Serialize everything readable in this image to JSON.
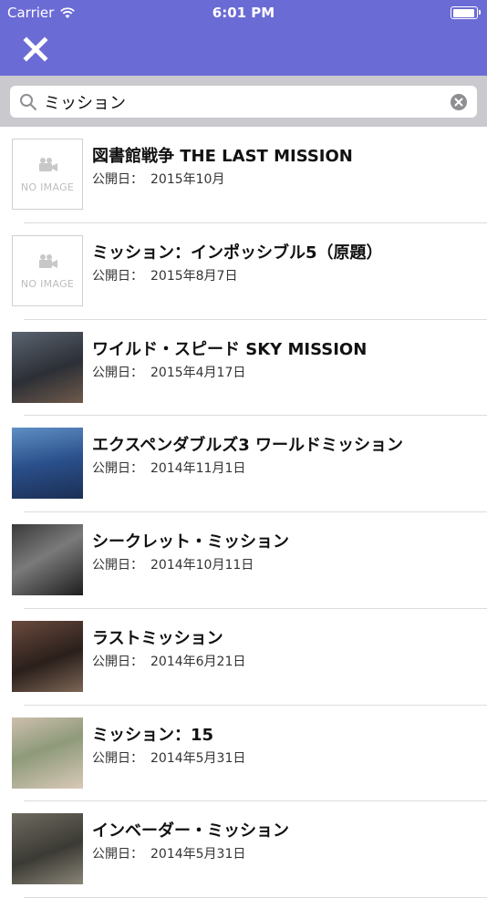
{
  "status_bar": {
    "carrier": "Carrier",
    "time": "6:01 PM",
    "icons": [
      "wifi-icon",
      "battery-icon"
    ]
  },
  "header": {
    "close_icon": "close-icon",
    "color": "#6B6BD6"
  },
  "search": {
    "value": "ミッション",
    "icons": [
      "search-icon",
      "clear-icon"
    ]
  },
  "results": [
    {
      "title": "図書館戦争 THE LAST MISSION",
      "date_label": "公開日：",
      "date": "2015年10月",
      "thumb": "no-image",
      "no_image_text": "NO IMAGE"
    },
    {
      "title": "ミッション：インポッシブル5（原題）",
      "date_label": "公開日：",
      "date": "2015年8月7日",
      "thumb": "no-image",
      "no_image_text": "NO IMAGE"
    },
    {
      "title": "ワイルド・スピード SKY MISSION",
      "date_label": "公開日：",
      "date": "2015年4月17日",
      "thumb": "photo"
    },
    {
      "title": "エクスペンダブルズ3 ワールドミッション",
      "date_label": "公開日：",
      "date": "2014年11月1日",
      "thumb": "photo"
    },
    {
      "title": "シークレット・ミッション",
      "date_label": "公開日：",
      "date": "2014年10月11日",
      "thumb": "photo"
    },
    {
      "title": "ラストミッション",
      "date_label": "公開日：",
      "date": "2014年6月21日",
      "thumb": "photo"
    },
    {
      "title": "ミッション：15",
      "date_label": "公開日：",
      "date": "2014年5月31日",
      "thumb": "photo"
    },
    {
      "title": "インベーダー・ミッション",
      "date_label": "公開日：",
      "date": "2014年5月31日",
      "thumb": "photo"
    }
  ]
}
